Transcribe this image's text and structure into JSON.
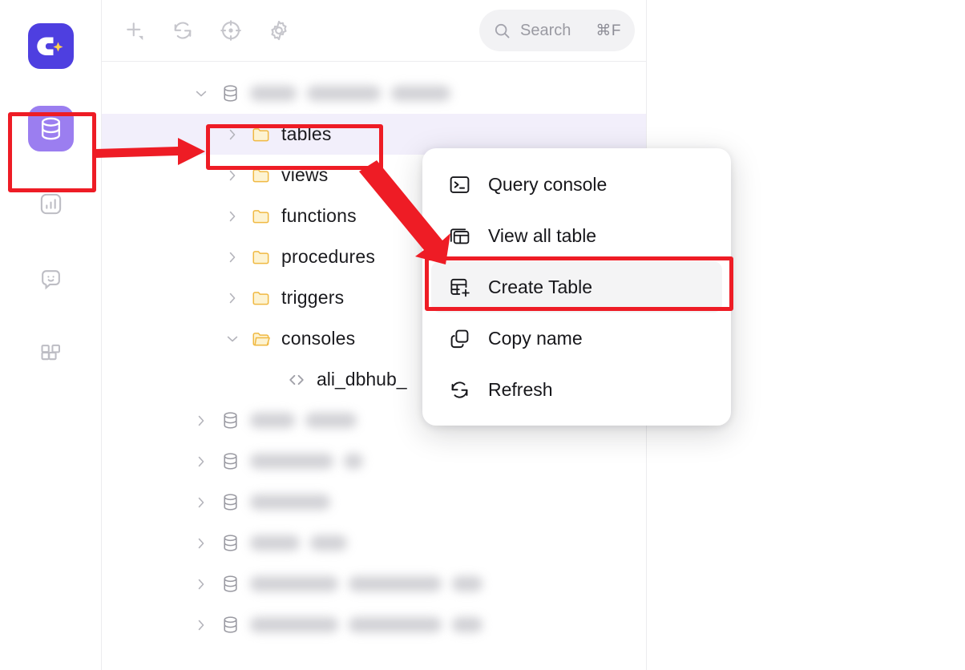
{
  "app": {
    "logo_icon": "dbhub-logo-icon",
    "accent_color": "#4e3fe0",
    "active_nav_color": "#9b7ef0",
    "annotation_color": "#ee1c25",
    "selected_row_color": "#f2effb"
  },
  "activity_bar": {
    "items": [
      {
        "id": "database",
        "icon": "database-icon",
        "label": "Database",
        "active": true
      },
      {
        "id": "dashboard",
        "icon": "bar-chart-icon",
        "label": "Dashboard",
        "active": false
      },
      {
        "id": "chat",
        "icon": "chat-smiley-icon",
        "label": "AI Chat",
        "active": false
      },
      {
        "id": "workspace",
        "icon": "blocks-icon",
        "label": "Workspace",
        "active": false
      }
    ]
  },
  "toolbar": {
    "buttons": [
      {
        "id": "add",
        "icon": "plus-dropdown-icon",
        "label": "Add"
      },
      {
        "id": "refresh",
        "icon": "refresh-icon",
        "label": "Refresh"
      },
      {
        "id": "focus",
        "icon": "target-icon",
        "label": "Locate"
      },
      {
        "id": "settings",
        "icon": "gear-icon",
        "label": "Settings"
      }
    ],
    "search": {
      "icon": "search-icon",
      "placeholder": "Search",
      "shortcut": "⌘F"
    }
  },
  "tree": {
    "rows": [
      {
        "id": "db-root",
        "depth": 0,
        "chevron": "down",
        "icon": "database-icon",
        "label": "",
        "redacted": true,
        "redacted_widths": [
          58,
          92,
          74
        ],
        "selected": false
      },
      {
        "id": "tables",
        "depth": 1,
        "chevron": "right",
        "icon": "folder-icon",
        "label": "tables",
        "redacted": false,
        "selected": true
      },
      {
        "id": "views",
        "depth": 1,
        "chevron": "right",
        "icon": "folder-icon",
        "label": "views",
        "redacted": false,
        "selected": false
      },
      {
        "id": "functions",
        "depth": 1,
        "chevron": "right",
        "icon": "folder-icon",
        "label": "functions",
        "redacted": false,
        "selected": false
      },
      {
        "id": "procedures",
        "depth": 1,
        "chevron": "right",
        "icon": "folder-icon",
        "label": "procedures",
        "redacted": false,
        "selected": false
      },
      {
        "id": "triggers",
        "depth": 1,
        "chevron": "right",
        "icon": "folder-icon",
        "label": "triggers",
        "redacted": false,
        "selected": false
      },
      {
        "id": "consoles",
        "depth": 1,
        "chevron": "down",
        "icon": "folder-open-icon",
        "label": "consoles",
        "redacted": false,
        "selected": false
      },
      {
        "id": "console-file",
        "depth": 2,
        "chevron": "none",
        "icon": "code-icon",
        "label": "ali_dbhub_",
        "redacted": false,
        "selected": false
      },
      {
        "id": "db-2",
        "depth": 0,
        "chevron": "right",
        "icon": "database-icon",
        "label": "",
        "redacted": true,
        "redacted_widths": [
          56,
          64
        ],
        "selected": false
      },
      {
        "id": "db-3",
        "depth": 0,
        "chevron": "right",
        "icon": "database-icon",
        "label": "",
        "redacted": true,
        "redacted_widths": [
          104,
          24
        ],
        "selected": false
      },
      {
        "id": "db-4",
        "depth": 0,
        "chevron": "right",
        "icon": "database-icon",
        "label": "",
        "redacted": true,
        "redacted_widths": [
          100
        ],
        "selected": false
      },
      {
        "id": "db-5",
        "depth": 0,
        "chevron": "right",
        "icon": "database-icon",
        "label": "",
        "redacted": true,
        "redacted_widths": [
          62,
          46
        ],
        "selected": false
      },
      {
        "id": "db-6",
        "depth": 0,
        "chevron": "right",
        "icon": "database-icon",
        "label": "",
        "redacted": true,
        "redacted_widths": [
          110,
          116,
          38
        ],
        "selected": false
      },
      {
        "id": "db-7",
        "depth": 0,
        "chevron": "right",
        "icon": "database-icon",
        "label": "",
        "redacted": true,
        "redacted_widths": [
          110,
          116,
          38
        ],
        "selected": false
      }
    ]
  },
  "context_menu": {
    "items": [
      {
        "id": "query-console",
        "icon": "terminal-icon",
        "label": "Query console",
        "highlighted": false
      },
      {
        "id": "view-all-table",
        "icon": "table-stack-icon",
        "label": "View all table",
        "highlighted": false
      },
      {
        "id": "create-table",
        "icon": "table-plus-icon",
        "label": "Create Table",
        "highlighted": true
      },
      {
        "id": "copy-name",
        "icon": "copy-icon",
        "label": "Copy name",
        "highlighted": false
      },
      {
        "id": "refresh",
        "icon": "refresh-icon",
        "label": "Refresh",
        "highlighted": false
      }
    ]
  },
  "annotations": {
    "boxes": [
      {
        "id": "db-nav-highlight",
        "target": "activity-bar-database-icon"
      },
      {
        "id": "tables-node-highlight",
        "target": "tree-row-tables"
      },
      {
        "id": "create-table-highlight",
        "target": "menu-item-create-table"
      }
    ],
    "arrows": [
      {
        "id": "arrow-nav-to-tables",
        "from": "db-nav-highlight",
        "to": "tables-node-highlight"
      },
      {
        "id": "arrow-tables-to-createtable",
        "from": "tables-node-highlight",
        "to": "create-table-highlight"
      }
    ]
  }
}
